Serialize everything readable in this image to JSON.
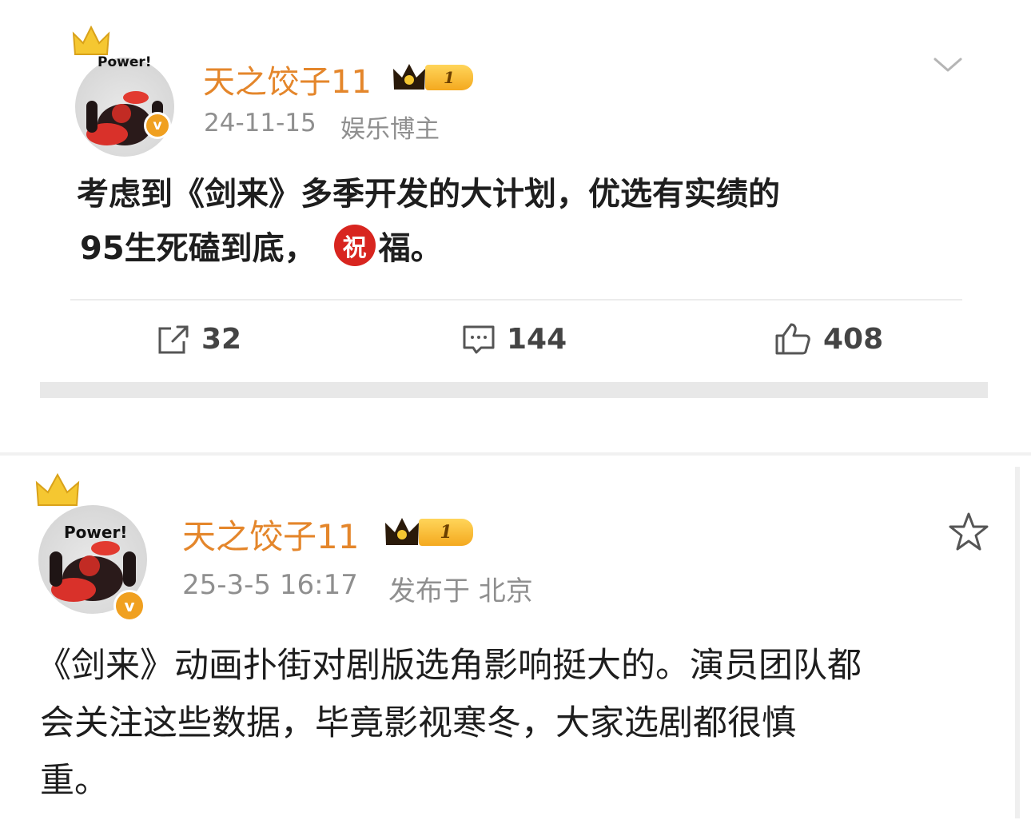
{
  "post1": {
    "username": "天之饺子11",
    "level": "1",
    "avatar_text": "Power!",
    "verified_mark": "v",
    "date": "24-11-15",
    "tag": "娱乐博主",
    "text_line1": "考虑到《剑来》多季开发的大计划，优选有实绩的",
    "text_line2_a": "95生死磕到底，",
    "emoji_char": "祝",
    "text_line2_b": "福。",
    "actions": {
      "repost_count": "32",
      "comment_count": "144",
      "like_count": "408"
    }
  },
  "post2": {
    "username": "天之饺子11",
    "level": "1",
    "avatar_text": "Power!",
    "verified_mark": "v",
    "date": "25-3-5 16:17",
    "location": "发布于 北京",
    "text_line1": "《剑来》动画扑街对剧版选角影响挺大的。演员团队都",
    "text_line2": "会关注这些数据，毕竟影视寒冬，大家选剧都很慎",
    "text_line3": "重。"
  },
  "icons": [
    "chevron-down-icon",
    "crown-icon",
    "repost-icon",
    "comment-icon",
    "like-icon",
    "star-icon",
    "verified-icon"
  ]
}
